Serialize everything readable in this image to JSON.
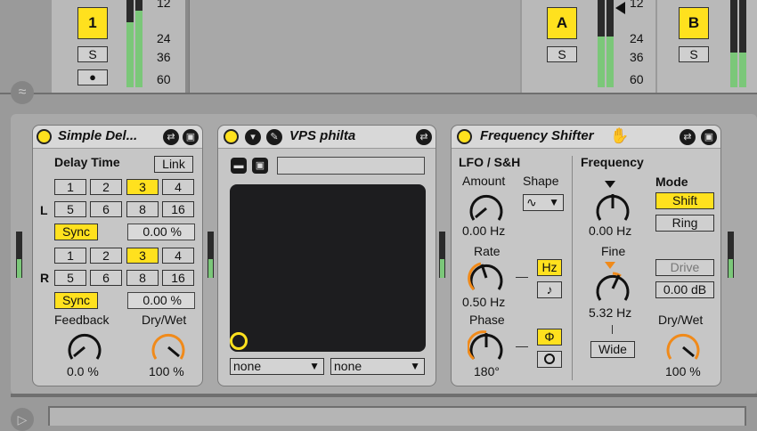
{
  "tracks": {
    "track1": {
      "number": "1",
      "solo": "S",
      "arm": "●",
      "scale": [
        "12",
        "24",
        "36",
        "60"
      ]
    },
    "trackA": {
      "name": "A",
      "solo": "S",
      "scale": [
        "12",
        "24",
        "36",
        "60"
      ]
    },
    "trackB": {
      "name": "B",
      "solo": "S"
    }
  },
  "simple_delay": {
    "title": "Simple Del...",
    "delay_time_label": "Delay Time",
    "link_label": "Link",
    "left_label": "L",
    "right_label": "R",
    "beats_row1": [
      "1",
      "2",
      "3",
      "4"
    ],
    "beats_row2": [
      "5",
      "6",
      "8",
      "16"
    ],
    "selected_beat": "3",
    "sync_label": "Sync",
    "left_offset": "0.00 %",
    "right_offset": "0.00 %",
    "feedback_label": "Feedback",
    "feedback_value": "0.0 %",
    "drywet_label": "Dry/Wet",
    "drywet_value": "100 %"
  },
  "vps": {
    "title": "VPS philta",
    "select_left": "none",
    "select_right": "none"
  },
  "freq_shifter": {
    "title": "Frequency Shifter",
    "lfo_label": "LFO / S&H",
    "amount_label": "Amount",
    "amount_value": "0.00 Hz",
    "shape_label": "Shape",
    "shape_value": "∿",
    "rate_label": "Rate",
    "rate_value": "0.50 Hz",
    "hz_label": "Hz",
    "note_label": "♪",
    "phase_label": "Phase",
    "phase_value": "180°",
    "phi_label": "Φ",
    "frequency_label": "Frequency",
    "frequency_value": "0.00 Hz",
    "fine_label": "Fine",
    "fine_value": "5.32 Hz",
    "wide_label": "Wide",
    "mode_label": "Mode",
    "shift_label": "Shift",
    "ring_label": "Ring",
    "drive_label": "Drive",
    "drive_value": "0.00 dB",
    "drywet_label": "Dry/Wet",
    "drywet_value": "100 %"
  },
  "colors": {
    "accent": "#ffe11e",
    "meter": "#7bc779",
    "knob_orange": "#f08a1a"
  }
}
